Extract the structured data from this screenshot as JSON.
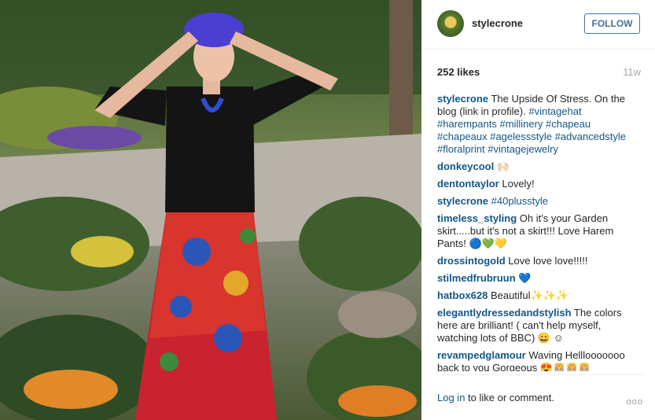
{
  "post": {
    "username": "stylecrone",
    "follow_label": "FOLLOW",
    "likes": "252 likes",
    "age": "11w"
  },
  "caption": {
    "user": "stylecrone",
    "text": "The Upside Of Stress. On the blog (link in profile).",
    "tags": "#vintagehat #harempants #millinery #chapeau #chapeaux #agelessstyle #advancedstyle #floralprint #vintagejewelry"
  },
  "comments": [
    {
      "user": "donkeycool",
      "text": "🙌🏻"
    },
    {
      "user": "dentontaylor",
      "text": "Lovely!"
    },
    {
      "user": "stylecrone",
      "text": "#40plusstyle"
    },
    {
      "user": "timeless_styling",
      "text": "Oh it's your Garden skirt.....but it's not a skirt!!! Love Harem Pants! 🔵💚💛"
    },
    {
      "user": "drossintogold",
      "text": "Love love love!!!!!"
    },
    {
      "user": "stilmedfrubruun",
      "text": "💙"
    },
    {
      "user": "hatbox628",
      "text": "Beautiful✨✨✨"
    },
    {
      "user": "elegantlydressedandstylish",
      "text": "The colors here are brilliant! ( can't help myself, watching lots of BBC) 😀 ☺"
    },
    {
      "user": "revampedglamour",
      "text": "Waving Helllooooooo back to you Gorgeous 😍👸🏼👸🏼👸🏼"
    }
  ],
  "footer": {
    "login_link": "Log in",
    "login_rest": " to like or comment.",
    "more": "ooo"
  },
  "icons": {
    "more": "more-options-icon"
  }
}
